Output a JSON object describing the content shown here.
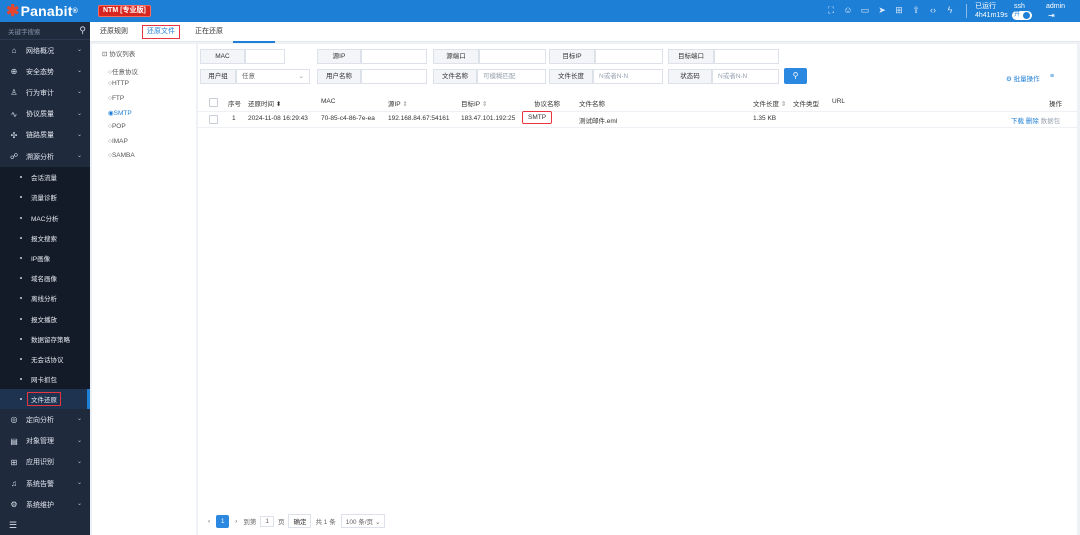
{
  "app": {
    "logo": "Panabit",
    "logo_reg": "®",
    "edition_badge": "NTM [专业版]"
  },
  "topbar": {
    "runtime_label": "已运行",
    "runtime_value": "4h41m19s",
    "ssh_label": "ssh",
    "ssh_toggle": "开",
    "user": "admin",
    "icons": [
      "fullscreen-icon",
      "chat-icon",
      "book-icon",
      "send-icon",
      "layout-icon",
      "upload-icon",
      "code-icon",
      "flash-icon"
    ]
  },
  "sidebar": {
    "search_placeholder": "关键字搜索",
    "groups_top": [
      {
        "name": "network-overview",
        "label": "网络概况",
        "icon": "⌂"
      },
      {
        "name": "security-situation",
        "label": "安全态势",
        "icon": "⊕"
      },
      {
        "name": "behavior-audit",
        "label": "行为审计",
        "icon": "♙"
      },
      {
        "name": "protocol-quality",
        "label": "协议质量",
        "icon": "∿"
      },
      {
        "name": "link-quality",
        "label": "链路质量",
        "icon": "✣"
      },
      {
        "name": "traceback-analysis",
        "label": "溯源分析",
        "icon": "☍"
      }
    ],
    "sub_items": [
      "会话流量",
      "流量诊断",
      "MAC分析",
      "报文搜索",
      "IP画像",
      "域名画像",
      "离线分析",
      "报文播放",
      "数据留存策略",
      "无会话协议",
      "网卡抓包",
      "文件还原"
    ],
    "active_sub": "文件还原",
    "groups_bottom": [
      {
        "name": "directional-analysis",
        "label": "定向分析",
        "icon": "◎"
      },
      {
        "name": "object-management",
        "label": "对象管理",
        "icon": "▤"
      },
      {
        "name": "app-recognition",
        "label": "应用识别",
        "icon": "⊞"
      },
      {
        "name": "system-alarm",
        "label": "系统告警",
        "icon": "♫"
      },
      {
        "name": "system-maintenance",
        "label": "系统维护",
        "icon": "⚙"
      }
    ],
    "collapse_icon": "☰"
  },
  "tabs": [
    "还原规则",
    "还原文件",
    "正在还原"
  ],
  "active_tab": "还原文件",
  "protocol_panel": {
    "title": "协议列表",
    "items": [
      "任意协议",
      "HTTP",
      "FTP",
      "SMTP",
      "POP",
      "IMAP",
      "SAMBA"
    ],
    "selected": "SMTP"
  },
  "filters": {
    "mac_label": "MAC",
    "src_ip_label": "源IP",
    "src_port_label": "源端口",
    "dst_ip_label": "目标IP",
    "dst_port_label": "目标端口",
    "user_group_label": "用户组",
    "user_group_value": "任意",
    "user_name_label": "用户名称",
    "file_name_label": "文件名称",
    "file_name_placeholder": "可模糊匹配",
    "file_length_label": "文件长度",
    "file_length_placeholder": "N或者N-N",
    "status_code_label": "状态码",
    "status_code_placeholder": "N或者N-N",
    "batch_ops": "批量操作"
  },
  "table": {
    "headers": {
      "index": "序号",
      "time": "还原时间",
      "mac": "MAC",
      "src_ip": "源IP",
      "dst_ip": "目标IP",
      "protocol": "协议名称",
      "file_name": "文件名称",
      "file_size": "文件长度",
      "file_type": "文件类型",
      "url": "URL",
      "ops": "操作"
    },
    "rows": [
      {
        "index": "1",
        "time": "2024-11-08 16:29:43",
        "mac": "70-85-c4-86-7e-ea",
        "src_ip": "192.168.84.67:54161",
        "dst_ip": "183.47.101.192:25",
        "protocol": "SMTP",
        "file_name": "测试邮件.eml",
        "file_size": "1.35 KB",
        "file_type": "",
        "url": "",
        "op_download": "下载",
        "op_delete": "删除",
        "op_packet": "数据包"
      }
    ]
  },
  "pager": {
    "current": "1",
    "goto_label": "到第",
    "goto_value": "1",
    "page_label": "页",
    "confirm": "确定",
    "total": "共 1 条",
    "page_size": "100 条/页"
  }
}
